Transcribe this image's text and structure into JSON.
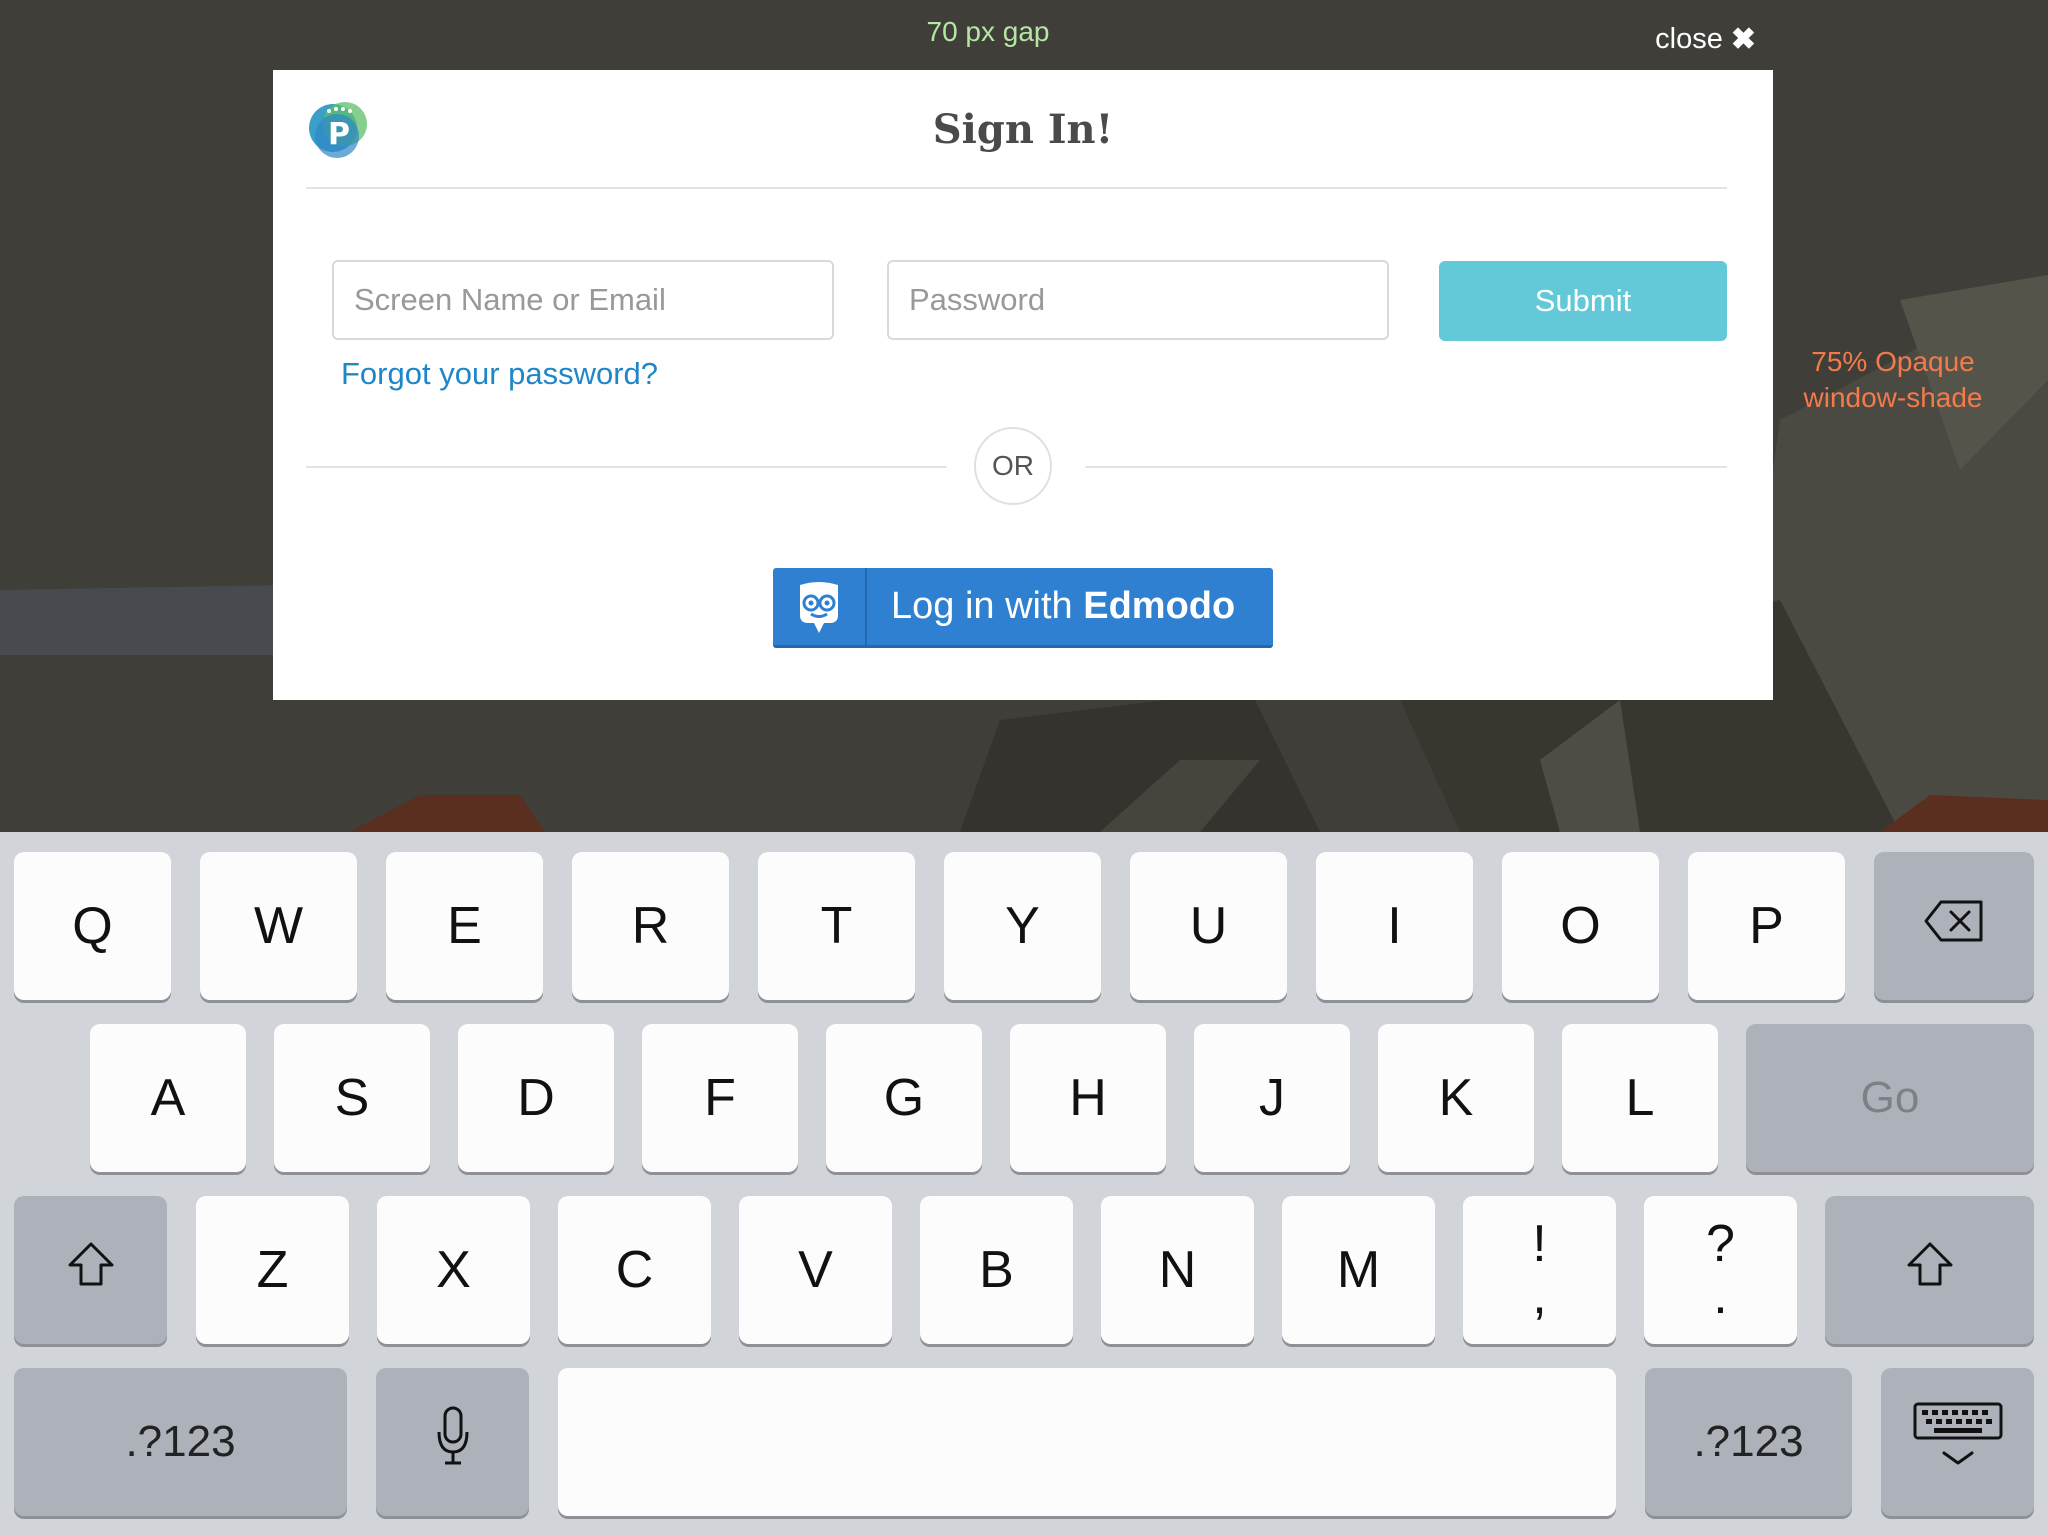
{
  "annotations": {
    "gap": "70 px gap",
    "shade_line1": "75% Opaque",
    "shade_line2": "window-shade"
  },
  "dialog": {
    "close_label": "close",
    "close_icon": "close-x-icon",
    "logo_icon": "p-logo-icon",
    "title": "Sign In!",
    "email_placeholder": "Screen Name or Email",
    "password_placeholder": "Password",
    "submit_label": "Submit",
    "forgot_label": "Forgot your password?",
    "or_label": "OR",
    "edmodo_prefix": "Log in with ",
    "edmodo_brand": "Edmodo",
    "edmodo_icon": "edmodo-owl-icon"
  },
  "colors": {
    "submit": "#63c9d9",
    "edmodo": "#2f80d1",
    "link": "#1f87c8"
  },
  "keyboard": {
    "row1": [
      "Q",
      "W",
      "E",
      "R",
      "T",
      "Y",
      "U",
      "I",
      "O",
      "P"
    ],
    "row2": [
      "A",
      "S",
      "D",
      "F",
      "G",
      "H",
      "J",
      "K",
      "L"
    ],
    "row3": [
      "Z",
      "X",
      "C",
      "V",
      "B",
      "N",
      "M"
    ],
    "punct1_top": "!",
    "punct1_bottom": ",",
    "punct2_top": "?",
    "punct2_bottom": ".",
    "go_label": "Go",
    "numbers_label": ".?123",
    "backspace_icon": "backspace-icon",
    "shift_icon": "shift-icon",
    "mic_icon": "microphone-icon",
    "hide_keyboard_icon": "hide-keyboard-icon"
  }
}
